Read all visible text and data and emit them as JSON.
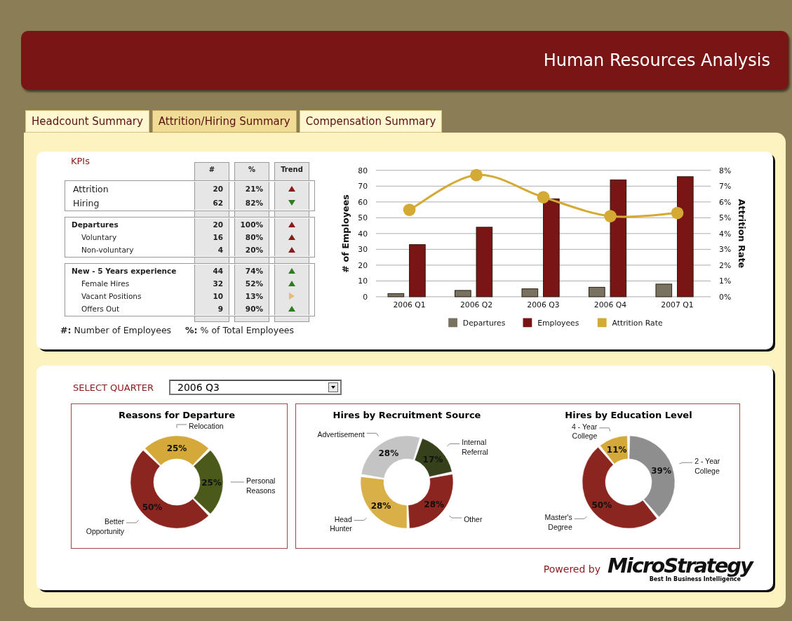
{
  "header": {
    "title": "Human Resources Analysis"
  },
  "tabs": [
    {
      "label": "Headcount Summary",
      "selected": false
    },
    {
      "label": "Attrition/Hiring Summary",
      "selected": true
    },
    {
      "label": "Compensation Summary",
      "selected": false
    }
  ],
  "kpis": {
    "title": "KPIs",
    "columns": [
      "#",
      "%",
      "Trend"
    ],
    "groups": [
      {
        "rows": [
          {
            "kind": "main",
            "label": "Attrition",
            "count": "20",
            "percent": "21%",
            "trend": {
              "kind": "up",
              "color": "#8b1a1a"
            }
          },
          {
            "kind": "main",
            "label": "Hiring",
            "count": "62",
            "percent": "82%",
            "trend": {
              "kind": "down",
              "color": "#2e7d1e"
            }
          }
        ]
      },
      {
        "rows": [
          {
            "kind": "header",
            "label": "Departures",
            "count": "20",
            "percent": "100%",
            "trend": {
              "kind": "up",
              "color": "#8b1a1a"
            }
          },
          {
            "kind": "sub",
            "label": "Voluntary",
            "count": "16",
            "percent": "80%",
            "trend": {
              "kind": "up",
              "color": "#8b1a1a"
            }
          },
          {
            "kind": "sub",
            "label": "Non-voluntary",
            "count": "4",
            "percent": "20%",
            "trend": {
              "kind": "up",
              "color": "#8b1a1a"
            }
          }
        ]
      },
      {
        "rows": [
          {
            "kind": "header",
            "label": "New - 5 Years experience",
            "count": "44",
            "percent": "74%",
            "trend": {
              "kind": "up",
              "color": "#2e7d1e"
            }
          },
          {
            "kind": "sub",
            "label": "Female Hires",
            "count": "32",
            "percent": "52%",
            "trend": {
              "kind": "up",
              "color": "#2e7d1e"
            }
          },
          {
            "kind": "sub",
            "label": "Vacant Positions",
            "count": "10",
            "percent": "13%",
            "trend": {
              "kind": "flat",
              "color": "#e3be72"
            }
          },
          {
            "kind": "sub",
            "label": "Offers Out",
            "count": "9",
            "percent": "90%",
            "trend": {
              "kind": "up",
              "color": "#2e7d1e"
            }
          }
        ]
      }
    ],
    "notes": [
      "**#:** Number of Employees",
      "**%:** % of Total Employees"
    ]
  },
  "trend_chart": {
    "chart_data": {
      "type": "bar",
      "categories": [
        "2006 Q1",
        "2006 Q2",
        "2006 Q3",
        "2006 Q4",
        "2007 Q1"
      ],
      "ylabel": "# of Employees",
      "y2label": "Attrition Rate",
      "ylim": [
        0,
        80
      ],
      "yticks": [
        0,
        10,
        20,
        30,
        40,
        50,
        60,
        70,
        80
      ],
      "grid": true,
      "legend": "bottom",
      "y2lim": [
        0,
        8
      ],
      "y2ticks": [
        {
          "value": 0,
          "label": "0%"
        },
        {
          "value": 1,
          "label": "1%"
        },
        {
          "value": 2,
          "label": "2%"
        },
        {
          "value": 3,
          "label": "3%"
        },
        {
          "value": 4,
          "label": "4%"
        },
        {
          "value": 5,
          "label": "5%"
        },
        {
          "value": 6,
          "label": "6%"
        },
        {
          "value": 7,
          "label": "7%"
        },
        {
          "value": 8,
          "label": "8%"
        }
      ],
      "series": [
        {
          "name": "Departures",
          "color": "#7a7260",
          "type": "bar",
          "values": [
            2,
            4,
            5,
            6,
            8
          ]
        },
        {
          "name": "Employees",
          "color": "#7a1515",
          "type": "bar",
          "values": [
            33,
            44,
            62,
            74,
            76
          ]
        },
        {
          "name": "Attrition Rate",
          "color": "#d4a934",
          "type": "line",
          "axis": "y2",
          "marker": "o",
          "values": [
            5.5,
            7.7,
            6.3,
            5.1,
            5.3
          ]
        }
      ]
    }
  },
  "quarter": {
    "label": "SELECT QUARTER",
    "value": "2006 Q3"
  },
  "panels": [
    {
      "charts": [
        {
          "chart_data": {
            "type": "donut",
            "title": "Reasons for Departure",
            "categories": [
              "Relocation",
              "Personal Reasons",
              "Better Opportunity"
            ],
            "values": [
              25,
              25,
              50
            ],
            "value_labels": [
              "25%",
              "25%",
              "50%"
            ],
            "colors": [
              "#d4a93a",
              "#4b5a1a",
              "#8b2520"
            ]
          }
        }
      ]
    },
    {
      "charts": [
        {
          "chart_data": {
            "type": "donut",
            "title": "Hires by Recruitment Source",
            "categories": [
              "Internal Referral",
              "Other",
              "Head Hunter",
              "Advertisement"
            ],
            "values": [
              17,
              28,
              28,
              28
            ],
            "value_labels": [
              "17%",
              "28%",
              "28%",
              "28%"
            ],
            "colors": [
              "#36401a",
              "#8b2520",
              "#d9b048",
              "#c4c4c4"
            ]
          }
        },
        {
          "chart_data": {
            "type": "donut",
            "title": "Hires by Education Level",
            "categories": [
              "2 - Year College",
              "Master's Degree",
              "4 - Year College"
            ],
            "values": [
              39,
              50,
              11
            ],
            "value_labels": [
              "39%",
              "50%",
              "11%"
            ],
            "colors": [
              "#8e8e8e",
              "#8b2520",
              "#d4a93a"
            ]
          }
        }
      ]
    }
  ],
  "footer": {
    "powered_by": "Powered by",
    "logo": "MicroStrategy",
    "tagline": "Best In Business Intelligence"
  }
}
